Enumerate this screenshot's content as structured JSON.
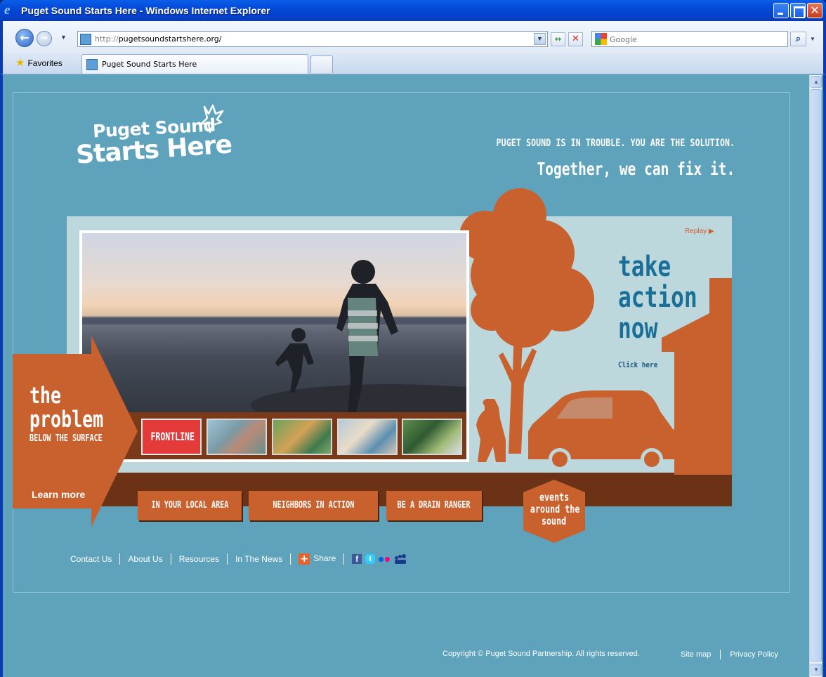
{
  "window": {
    "title": "Puget Sound Starts Here - Windows Internet Explorer",
    "minimize_icon": "minimize-icon",
    "maximize_icon": "maximize-icon",
    "close_glyph": "✕"
  },
  "toolbar": {
    "back_glyph": "←",
    "forward_glyph": "→",
    "address_protocol": "http://",
    "address_rest": "pugetsoundstartshere.org/",
    "refresh_glyph": "↔",
    "stop_glyph": "✕",
    "search_placeholder": "Google",
    "search_glyph": "⌕"
  },
  "tabs": {
    "favorites_label": "Favorites",
    "active_tab_label": "Puget Sound Starts Here"
  },
  "page": {
    "logo_line1": "Puget Sound",
    "logo_line2": "Starts Here",
    "tagline": "PUGET SOUND IS IN TROUBLE. YOU ARE THE SOLUTION.",
    "tagline2": "Together, we can fix it.",
    "replay": "Replay ▶",
    "take_action_line1": "take",
    "take_action_line2": "action",
    "take_action_line3": "now",
    "click_here": "Click here",
    "frontline": "FRONTLINE",
    "problem_line1": "the",
    "problem_line2": "problem",
    "problem_sub": "BELOW THE SURFACE",
    "learn_more": "Learn more",
    "nav_buttons": [
      "IN YOUR LOCAL AREA",
      "NEIGHBORS IN ACTION",
      "BE A DRAIN RANGER"
    ],
    "events_line1": "events",
    "events_line2": "around the",
    "events_line3": "sound",
    "footer_links": [
      "Contact Us",
      "About Us",
      "Resources",
      "In The News",
      "Share"
    ],
    "share_glyph": "+",
    "copyright": "Copyright © Puget Sound Partnership. All rights reserved.",
    "bottom_links": [
      "Site map",
      "Privacy Policy"
    ]
  },
  "colors": {
    "page_bg": "#5ea3bb",
    "accent_orange": "#c9612f",
    "dark_brown": "#6b3216",
    "action_blue": "#1a6f99",
    "frontline_red": "#e53a3a"
  }
}
